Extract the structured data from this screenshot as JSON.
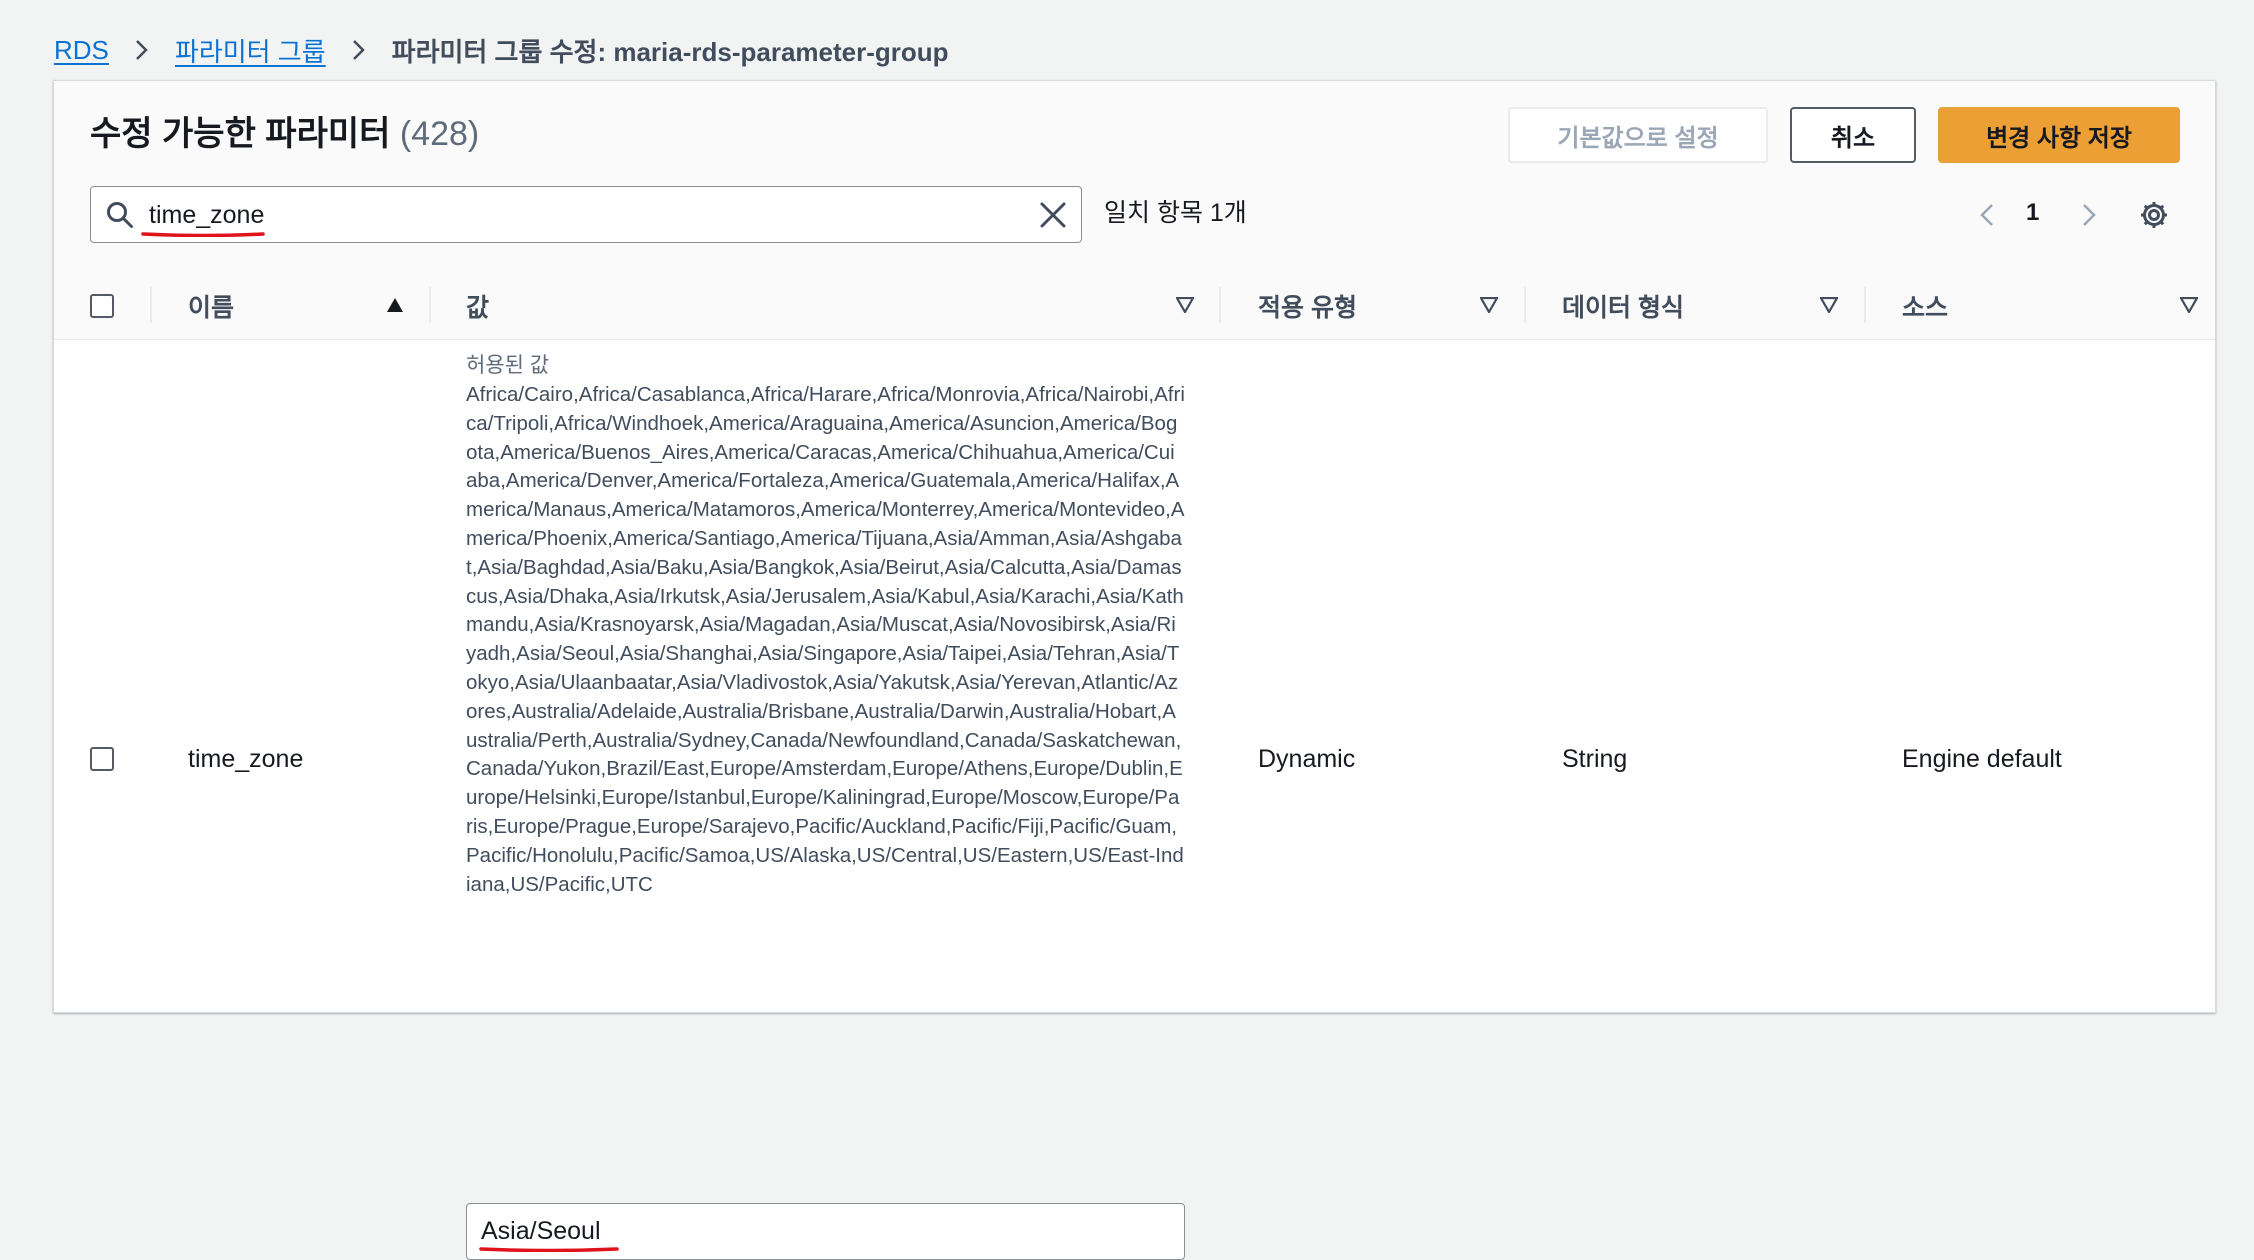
{
  "breadcrumb": {
    "items": [
      "RDS",
      "파라미터 그룹"
    ],
    "current": "파라미터 그룹 수정: maria-rds-parameter-group"
  },
  "panel": {
    "title": "수정 가능한 파라미터",
    "count": "(428)",
    "buttons": {
      "reset_default": "기본값으로 설정",
      "cancel": "취소",
      "save": "변경 사항 저장"
    },
    "search": {
      "value": "time_zone"
    },
    "match_text": "일치 항목 1개",
    "pagination": {
      "current_page": "1"
    }
  },
  "table": {
    "headers": {
      "name": "이름",
      "value": "값",
      "apply_type": "적용 유형",
      "data_type": "데이터 형식",
      "source": "소스"
    },
    "rows": [
      {
        "name": "time_zone",
        "allowed_label": "허용된 값",
        "allowed_values": "Africa/Cairo,Africa/Casablanca,Africa/Harare,Africa/Monrovia,Africa/Nairobi,Africa/Tripoli,Africa/Windhoek,America/Araguaina,America/Asuncion,America/Bogota,America/Buenos_Aires,America/Caracas,America/Chihuahua,America/Cuiaba,America/Denver,America/Fortaleza,America/Guatemala,America/Halifax,America/Manaus,America/Matamoros,America/Monterrey,America/Montevideo,America/Phoenix,America/Santiago,America/Tijuana,Asia/Amman,Asia/Ashgabat,Asia/Baghdad,Asia/Baku,Asia/Bangkok,Asia/Beirut,Asia/Calcutta,Asia/Damascus,Asia/Dhaka,Asia/Irkutsk,Asia/Jerusalem,Asia/Kabul,Asia/Karachi,Asia/Kathmandu,Asia/Krasnoyarsk,Asia/Magadan,Asia/Muscat,Asia/Novosibirsk,Asia/Riyadh,Asia/Seoul,Asia/Shanghai,Asia/Singapore,Asia/Taipei,Asia/Tehran,Asia/Tokyo,Asia/Ulaanbaatar,Asia/Vladivostok,Asia/Yakutsk,Asia/Yerevan,Atlantic/Azores,Australia/Adelaide,Australia/Brisbane,Australia/Darwin,Australia/Hobart,Australia/Perth,Australia/Sydney,Canada/Newfoundland,Canada/Saskatchewan,Canada/Yukon,Brazil/East,Europe/Amsterdam,Europe/Athens,Europe/Dublin,Europe/Helsinki,Europe/Istanbul,Europe/Kaliningrad,Europe/Moscow,Europe/Paris,Europe/Prague,Europe/Sarajevo,Pacific/Auckland,Pacific/Fiji,Pacific/Guam,Pacific/Honolulu,Pacific/Samoa,US/Alaska,US/Central,US/Eastern,US/East-Indiana,US/Pacific,UTC",
        "value": "Asia/Seoul",
        "apply_type": "Dynamic",
        "data_type": "String",
        "source": "Engine default"
      }
    ]
  },
  "colors": {
    "link": "#0972d3",
    "primary_button": "#ec9f35",
    "annotation": "#e0131b"
  }
}
